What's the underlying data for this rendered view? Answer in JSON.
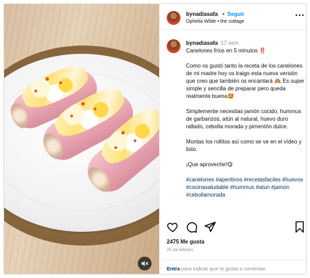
{
  "header": {
    "username": "bynadiasafa",
    "separator": "•",
    "follow_label": "Seguir",
    "location": "Ophelia Wilde • the cottage",
    "more_icon": "more-horizontal-icon"
  },
  "caption": {
    "username": "bynadiasafa",
    "time_ago": "17 sem",
    "paragraphs": [
      "Canelones fríos en 5 minutos ‼️",
      "Como os gustó tanto la receta de los canelones de mi madre hoy os traigo esta nueva versión que creo que también os encantará 🙈 Es super simple y sencilla de preparar pero queda realmente buena🤩",
      "Simplemente necesitas jamón cocido, hummus de garbanzos, atún al natural, huevo duro rallado, cebolla morada y pimentón dulce.",
      "Montas los rollitos así como se ve en el vídeo y listo.",
      "¡Que aproveche!😋"
    ],
    "hashtags": "#canelones #aperitivos #recetasfaciles #huevos #cocinasaludable #hummus #atun #jamon #cebollamorada"
  },
  "actions": {
    "like_icon": "heart-icon",
    "comment_icon": "comment-icon",
    "share_icon": "share-icon",
    "save_icon": "bookmark-icon"
  },
  "likes": "2475 Me gusta",
  "date": "25 de febrero",
  "comment": {
    "link_label": "Entra",
    "prompt": "para indicar que te gusta o comentar."
  },
  "media": {
    "mute_icon": "speaker-muted-icon"
  },
  "colors": {
    "link_blue": "#0095f6",
    "hashtag_blue": "#00376b",
    "muted_text": "#8e8e8e"
  }
}
